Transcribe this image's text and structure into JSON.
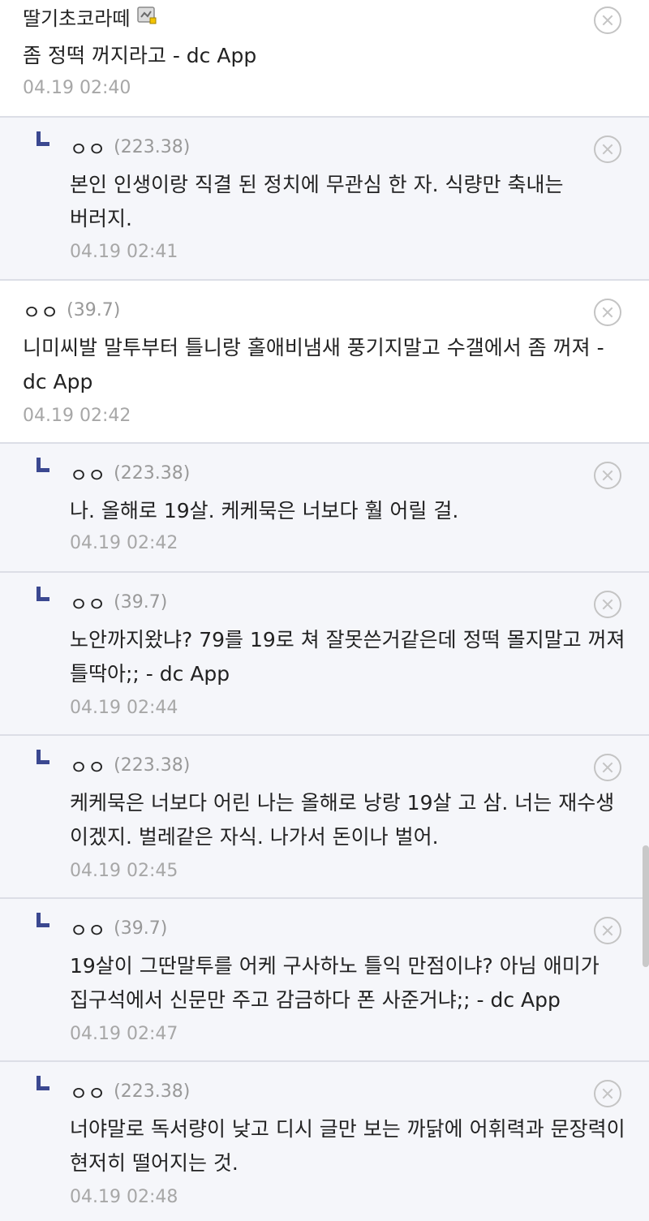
{
  "comments": [
    {
      "type": "top",
      "nickname": "딸기초코라떼",
      "badge": "gallery-nickname-icon",
      "ip": "",
      "text": "좀 정떡 꺼지라고 - dc App",
      "time": "04.19 02:40"
    },
    {
      "type": "reply",
      "nickname": "ㅇㅇ",
      "ip": "(223.38)",
      "text": "본인 인생이랑 직결 된 정치에 무관심 한 자. 식량만 축내는 버러지.",
      "time": "04.19 02:41"
    },
    {
      "type": "top",
      "nickname": "ㅇㅇ",
      "ip": "(39.7)",
      "text": "니미씨발 말투부터 틀니랑 홀애비냄새 풍기지말고 수갤에서 좀 꺼져 - dc App",
      "time": "04.19 02:42"
    },
    {
      "type": "reply",
      "nickname": "ㅇㅇ",
      "ip": "(223.38)",
      "text": "나. 올해로 19살. 케케묵은 너보다 훨 어릴 걸.",
      "time": "04.19 02:42"
    },
    {
      "type": "reply",
      "nickname": "ㅇㅇ",
      "ip": "(39.7)",
      "text": "노안까지왔냐? 79를 19로 쳐 잘못쓴거같은데 정떡 몰지말고 꺼져 틀딱아;; - dc App",
      "time": "04.19 02:44"
    },
    {
      "type": "reply",
      "nickname": "ㅇㅇ",
      "ip": "(223.38)",
      "text": "케케묵은 너보다 어린 나는 올해로 낭랑 19살 고 삼. 너는 재수생 이겠지. 벌레같은 자식. 나가서 돈이나 벌어.",
      "time": "04.19 02:45"
    },
    {
      "type": "reply",
      "nickname": "ㅇㅇ",
      "ip": "(39.7)",
      "text": "19살이 그딴말투를 어케 구사하노 틀익 만점이냐? 아님 애미가 집구석에서 신문만 주고 감금하다 폰 사준거냐;; - dc App",
      "time": "04.19 02:47"
    },
    {
      "type": "reply",
      "nickname": "ㅇㅇ",
      "ip": "(223.38)",
      "text": "너야말로 독서량이 낮고 디시 글만 보는 까닭에 어휘력과 문장력이 현저히 떨어지는 것.",
      "time": "04.19 02:48"
    }
  ],
  "colors": {
    "reply_bg": "#f5f6fa",
    "reply_icon": "#3b4890",
    "muted": "#a7a7a7"
  }
}
